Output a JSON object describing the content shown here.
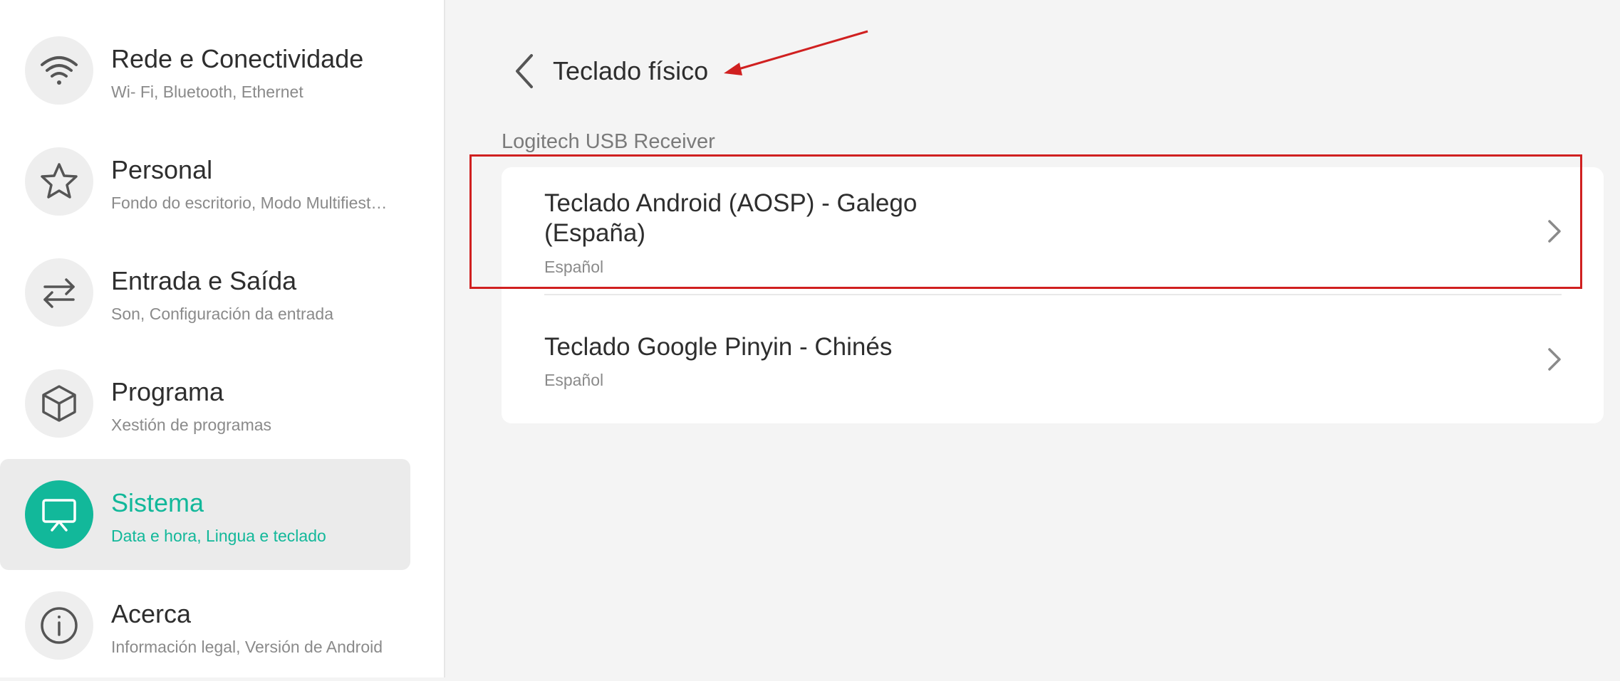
{
  "sidebar": {
    "items": [
      {
        "title": "Rede e Conectividade",
        "subtitle": "Wi- Fi, Bluetooth, Ethernet",
        "icon": "wifi-icon"
      },
      {
        "title": "Personal",
        "subtitle": "Fondo do escritorio, Modo Multifiest…",
        "icon": "star-icon"
      },
      {
        "title": "Entrada e Saída",
        "subtitle": "Son, Configuración da entrada",
        "icon": "swap-arrows-icon"
      },
      {
        "title": "Programa",
        "subtitle": "Xestión de programas",
        "icon": "cube-icon"
      },
      {
        "title": "Sistema",
        "subtitle": "Data e hora, Lingua e teclado",
        "icon": "monitor-icon",
        "active": true
      },
      {
        "title": "Acerca",
        "subtitle": "Información legal, Versión de Android",
        "icon": "info-icon"
      }
    ]
  },
  "header": {
    "back_icon": "back-chevron-icon",
    "title": "Teclado físico"
  },
  "section": {
    "device_name": "Logitech USB Receiver",
    "keyboards": [
      {
        "line1": "Teclado Android (AOSP) - Galego",
        "line2": "(España)",
        "subtitle": "Español"
      },
      {
        "line1": "Teclado Google Pinyin - Chinés",
        "subtitle": "Español"
      }
    ]
  },
  "colors": {
    "accent": "#12b89a",
    "annotation": "#d02020",
    "background": "#f4f4f4"
  }
}
